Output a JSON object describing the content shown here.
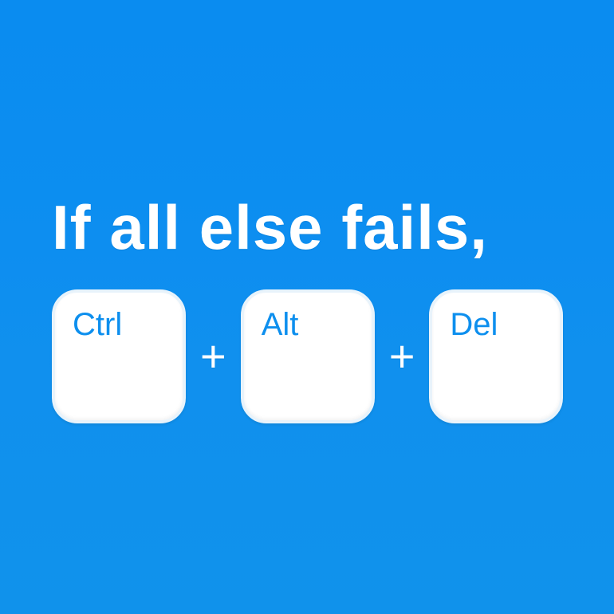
{
  "heading": "If all else fails,",
  "keys": {
    "ctrl": "Ctrl",
    "alt": "Alt",
    "del": "Del"
  },
  "separator": "+",
  "colors": {
    "background": "#0d8fee",
    "key_bg": "#ffffff",
    "key_text": "#0d8fee",
    "text": "#ffffff"
  }
}
